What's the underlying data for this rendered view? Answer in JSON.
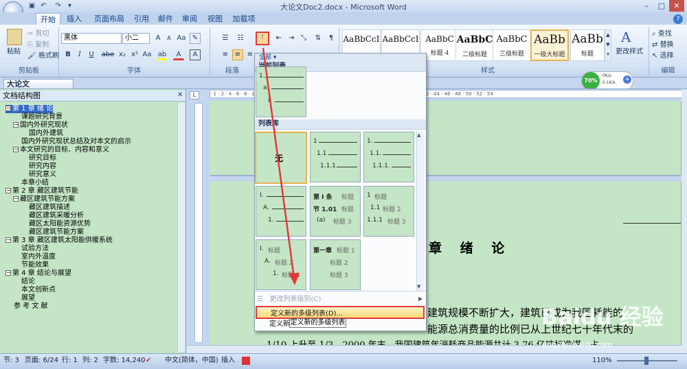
{
  "window": {
    "title": "大论文Doc2.docx - Microsoft Word",
    "min": "–",
    "max": "□",
    "close": "✕"
  },
  "tabs": [
    "开始",
    "插入",
    "页面布局",
    "引用",
    "邮件",
    "审阅",
    "视图",
    "加载项"
  ],
  "clipboard": {
    "paste": "粘贴",
    "cut": "剪切",
    "copy": "复制",
    "painter": "格式刷",
    "label": "剪贴板"
  },
  "font": {
    "name": "黑体",
    "size": "小二",
    "label": "字体",
    "grow": "A",
    "shrink": "A",
    "clear": "Aa",
    "bold": "B",
    "italic": "I",
    "underline": "U",
    "strike": "abe",
    "sub": "x₂",
    "sup": "x²",
    "case": "Aa",
    "highlight": "ab",
    "color": "A",
    "charbox": "A"
  },
  "paragraph": {
    "label": "段落"
  },
  "styles": {
    "label": "样式",
    "items": [
      {
        "preview": "AaBbCcI",
        "name": ""
      },
      {
        "preview": "AaBbCcI",
        "name": ""
      },
      {
        "preview": "AaBbC",
        "name": "标题 4"
      },
      {
        "preview": "AaBbC",
        "name": "二级标题"
      },
      {
        "preview": "AaBbC",
        "name": "三级标题"
      },
      {
        "preview": "AaBb",
        "name": "一级大标题"
      },
      {
        "preview": "AaBb",
        "name": "标题"
      }
    ],
    "change": "更改样式"
  },
  "editing": {
    "find": "查找",
    "replace": "替换",
    "select": "选择",
    "label": "编辑"
  },
  "network": {
    "percent": "70%",
    "up": "0K/s",
    "down": "0.1K/s"
  },
  "document": {
    "tab": "大论文Doc2.docx *"
  },
  "navpane": {
    "title": "文档结构图",
    "items": [
      {
        "text": "第 1 章  绪   论",
        "indent": 0,
        "toggle": "−",
        "selected": true
      },
      {
        "text": "课题研究背景",
        "indent": 1,
        "toggle": ""
      },
      {
        "text": "国内外研究现状",
        "indent": 1,
        "toggle": "−"
      },
      {
        "text": "国内外建筑",
        "indent": 2,
        "toggle": ""
      },
      {
        "text": "国内外研究现状总结及对本文的启示",
        "indent": 1,
        "toggle": ""
      },
      {
        "text": "本文研究的目标、内容和意义",
        "indent": 1,
        "toggle": "−"
      },
      {
        "text": "研究目标",
        "indent": 2,
        "toggle": ""
      },
      {
        "text": "研究内容",
        "indent": 2,
        "toggle": ""
      },
      {
        "text": "研究意义",
        "indent": 2,
        "toggle": ""
      },
      {
        "text": "本章小结",
        "indent": 1,
        "toggle": ""
      },
      {
        "text": "第 2 章  藏区建筑节能",
        "indent": 0,
        "toggle": "−"
      },
      {
        "text": "藏区建筑节能方案",
        "indent": 1,
        "toggle": "−"
      },
      {
        "text": "藏区建筑描述",
        "indent": 2,
        "toggle": ""
      },
      {
        "text": "藏区建筑采暖分析",
        "indent": 2,
        "toggle": ""
      },
      {
        "text": "藏区太阳能资源优势",
        "indent": 2,
        "toggle": ""
      },
      {
        "text": "藏区建筑节能方案",
        "indent": 2,
        "toggle": ""
      },
      {
        "text": "第 3 章  藏区建筑太阳能供暖系统",
        "indent": 0,
        "toggle": "−"
      },
      {
        "text": "试验方法",
        "indent": 1,
        "toggle": ""
      },
      {
        "text": "室内外温度",
        "indent": 1,
        "toggle": ""
      },
      {
        "text": "节能效果",
        "indent": 1,
        "toggle": ""
      },
      {
        "text": "第 4 章  结论与展望",
        "indent": 0,
        "toggle": "−"
      },
      {
        "text": "结论",
        "indent": 1,
        "toggle": ""
      },
      {
        "text": "本文创新点",
        "indent": 1,
        "toggle": ""
      },
      {
        "text": "展望",
        "indent": 1,
        "toggle": ""
      },
      {
        "text": "参 考 文 献",
        "indent": 0,
        "toggle": ""
      }
    ]
  },
  "dropdown": {
    "all": "全部 ▾",
    "current_header": "当前列表",
    "library_header": "列表库",
    "none": "无",
    "current_thumb": [
      "1.",
      "a)",
      "i."
    ],
    "t2": [
      "1",
      "1.1",
      "1.1.1"
    ],
    "t3": [
      "1.",
      "1.1.",
      "1.1.1."
    ],
    "t4": [
      "I.",
      "A.",
      "1."
    ],
    "t5": [
      "第 I 条",
      "标题",
      "节 1.01",
      "标题",
      "(a)",
      "标题 3"
    ],
    "t6": [
      "1",
      "标题",
      "1.1",
      "标题 2",
      "1.1.1",
      "标题 3"
    ],
    "t7": [
      "I.",
      "标题",
      "A.",
      "标题 2",
      "1.",
      "标题 3"
    ],
    "t8": [
      "第一章",
      "标题 1",
      "标题 2",
      "标题 3"
    ],
    "change_level": "更改列表级别(C)",
    "define_multi": "定义新的多级列表(D)...",
    "define_style": "定义新",
    "tooltip": "定义新的多级列表"
  },
  "page": {
    "chapter_title": "章 绪 论",
    "line1": "建筑规模不断扩大，建筑已成为我国耗能的",
    "line2": "能源总消费量的比例已从上世纪七十年代末的",
    "line3": "1/10 上升至 1/3。2000 年末，我国建筑年消耗商品能源共计 3.76 亿吨标准煤，占"
  },
  "status": {
    "section": "节: 3",
    "page": "页面: 6/24",
    "row": "行: 1",
    "col": "列: 2",
    "words": "字数: 14,240",
    "lang": "中文(简体，中国)",
    "insert": "插入",
    "zoom": "110%"
  },
  "watermark": {
    "brand": "Baidu 经验",
    "url": "jingyan.baidu.com"
  },
  "accent": {
    "red": "#e23a3a",
    "ribbon": "#dbe7f6",
    "doc_bg": "#c4e6c6"
  }
}
